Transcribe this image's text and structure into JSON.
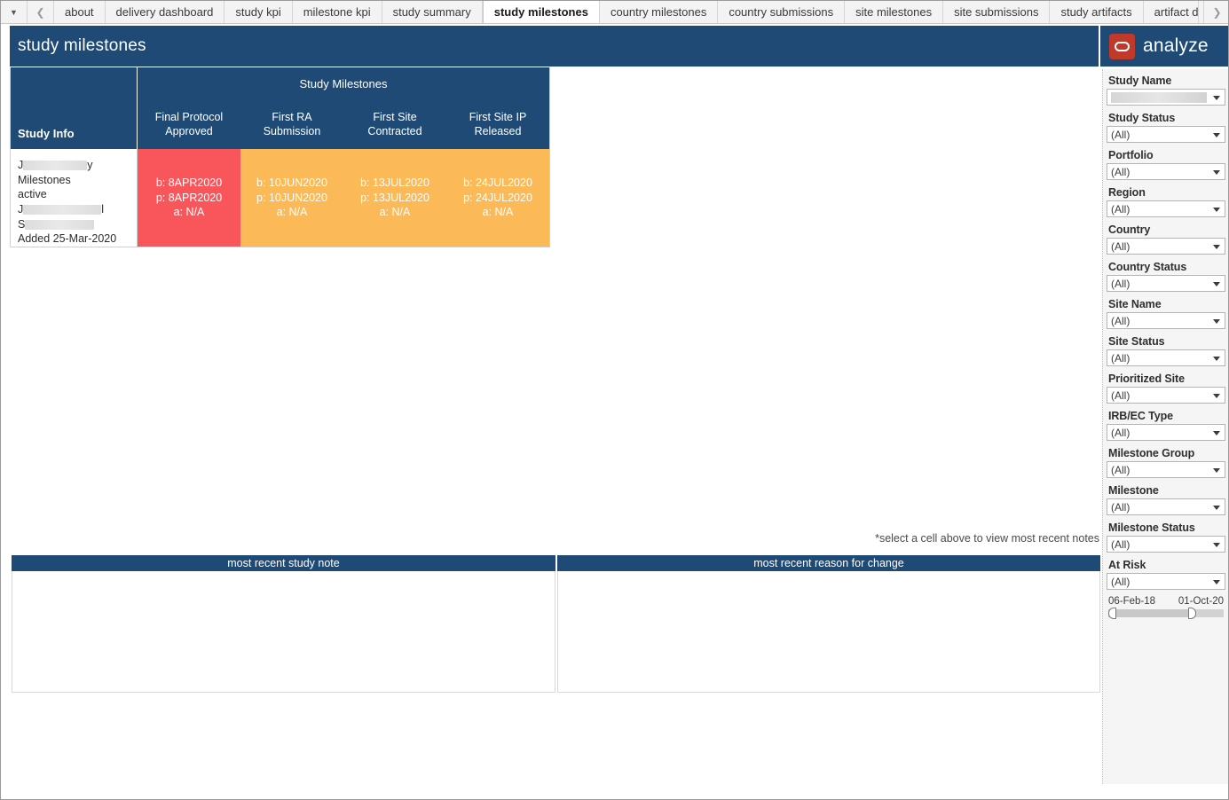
{
  "tabbar": {
    "dropdown_icon": "caret-down-icon",
    "prev_icon": "chevron-left-icon",
    "next_icon": "chevron-right-icon",
    "tabs": [
      {
        "label": "about",
        "active": false
      },
      {
        "label": "delivery dashboard",
        "active": false
      },
      {
        "label": "study kpi",
        "active": false
      },
      {
        "label": "milestone kpi",
        "active": false
      },
      {
        "label": "study summary",
        "active": false
      },
      {
        "label": "study milestones",
        "active": true
      },
      {
        "label": "country milestones",
        "active": false
      },
      {
        "label": "country submissions",
        "active": false
      },
      {
        "label": "site milestones",
        "active": false
      },
      {
        "label": "site submissions",
        "active": false
      },
      {
        "label": "study artifacts",
        "active": false
      },
      {
        "label": "artifact d",
        "active": false
      }
    ]
  },
  "header": {
    "title": "study milestones",
    "logo_text": "analyze",
    "logo_icon": "analyze-logo-icon",
    "bar_color": "#1e4a75",
    "logo_color": "#c0392b"
  },
  "milestone_table": {
    "study_info_header": "Study Info",
    "group_header": "Study Milestones",
    "columns": [
      "Final Protocol Approved",
      "First RA Submission",
      "First Site Contracted",
      "First Site IP Released"
    ],
    "row": {
      "study_name_prefix": "J",
      "study_name_suffix": "y",
      "line2": "Milestones",
      "status": "active",
      "line4_prefix": "J",
      "line4_suffix": "l",
      "line5_prefix": "S",
      "added": "Added 25-Mar-2020",
      "cells": [
        {
          "baseline": "b: 8APR2020",
          "planned": "p: 8APR2020",
          "actual": "a: N/A",
          "color": "red"
        },
        {
          "baseline": "b: 10JUN2020",
          "planned": "p: 10JUN2020",
          "actual": "a: N/A",
          "color": "orange"
        },
        {
          "baseline": "b: 13JUL2020",
          "planned": "p: 13JUL2020",
          "actual": "a: N/A",
          "color": "orange"
        },
        {
          "baseline": "b: 24JUL2020",
          "planned": "p: 24JUL2020",
          "actual": "a: N/A",
          "color": "orange"
        }
      ]
    },
    "colors": {
      "red": "#f9565c",
      "orange": "#fbb957",
      "header": "#1e4a75"
    }
  },
  "select_note": "*select a cell above to view most recent notes",
  "bottom_panels": {
    "left_title": "most recent study note",
    "right_title": "most recent reason for change",
    "left_body": "",
    "right_body": ""
  },
  "sidebar": {
    "filters": [
      {
        "label": "Study Name",
        "value": "",
        "redacted": true
      },
      {
        "label": "Study Status",
        "value": "(All)",
        "redacted": false
      },
      {
        "label": "Portfolio",
        "value": "(All)",
        "redacted": false
      },
      {
        "label": "Region",
        "value": "(All)",
        "redacted": false
      },
      {
        "label": "Country",
        "value": "(All)",
        "redacted": false
      },
      {
        "label": "Country Status",
        "value": "(All)",
        "redacted": false
      },
      {
        "label": "Site Name",
        "value": "(All)",
        "redacted": false
      },
      {
        "label": "Site Status",
        "value": "(All)",
        "redacted": false
      },
      {
        "label": "Prioritized Site",
        "value": "(All)",
        "redacted": false
      },
      {
        "label": "IRB/EC Type",
        "value": "(All)",
        "redacted": false
      },
      {
        "label": "Milestone Group",
        "value": "(All)",
        "redacted": false
      },
      {
        "label": "Milestone",
        "value": "(All)",
        "redacted": false
      },
      {
        "label": "Milestone Status",
        "value": "(All)",
        "redacted": false
      },
      {
        "label": "At Risk",
        "value": "(All)",
        "redacted": false
      }
    ],
    "date_range": {
      "start": "06-Feb-18",
      "end": "01-Oct-20"
    }
  }
}
